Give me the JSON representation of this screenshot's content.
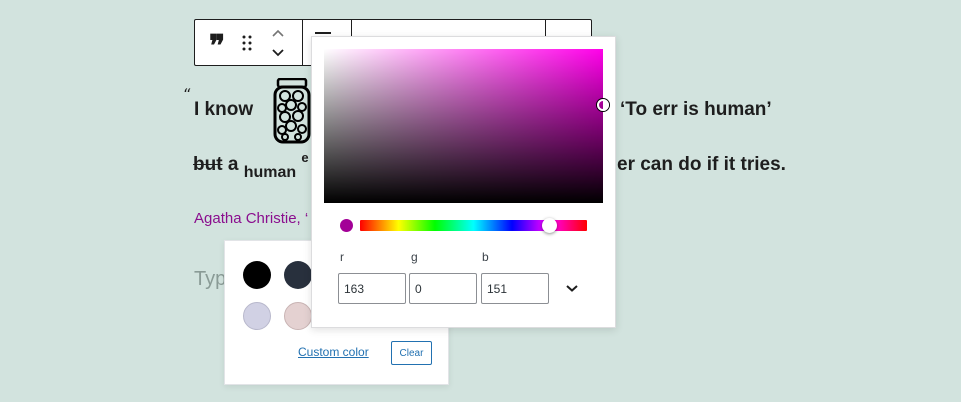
{
  "quote": {
    "mark": "“",
    "line1_left": "I know",
    "line1_right": "‘To err is human’",
    "line2_strike": "but",
    "line2_a": "a",
    "line2_sub": "human",
    "line2_sup": "e",
    "line2_right": "er can do if it tries.",
    "citation": "Agatha Christie, ‘",
    "placeholder": "Typ"
  },
  "palette": {
    "swatches": [
      "#000000",
      "#28303d",
      "#d1d1e4",
      "#e4d1d1"
    ],
    "custom_color_label": "Custom color",
    "clear_label": "Clear"
  },
  "picker": {
    "hue_color": "#ff00e9",
    "selected_color": "#a30097",
    "channels": [
      {
        "label": "r",
        "value": "163"
      },
      {
        "label": "g",
        "value": "0"
      },
      {
        "label": "b",
        "value": "151"
      }
    ]
  }
}
